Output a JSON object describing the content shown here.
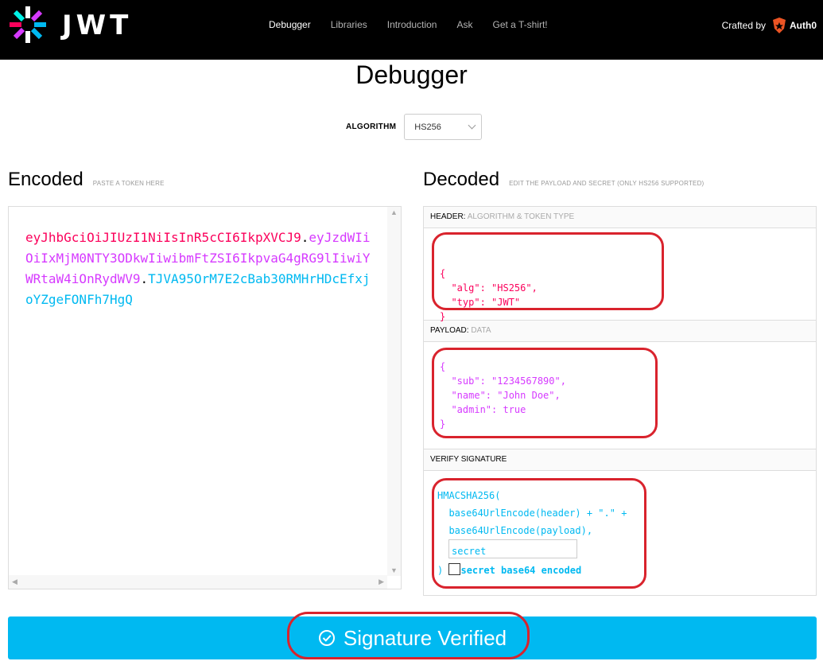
{
  "brand": {
    "name": "JWT"
  },
  "nav": {
    "items": [
      {
        "label": "Debugger"
      },
      {
        "label": "Libraries"
      },
      {
        "label": "Introduction"
      },
      {
        "label": "Ask"
      },
      {
        "label": "Get a T-shirt!"
      }
    ],
    "crafted_by": "Crafted by",
    "crafted_brand": "Auth0"
  },
  "page": {
    "title": "Debugger"
  },
  "algorithm": {
    "label": "ALGORITHM",
    "value": "HS256"
  },
  "encoded": {
    "title": "Encoded",
    "hint": "PASTE A TOKEN HERE",
    "token_header": "eyJhbGciOiJIUzI1NiIsInR5cCI6IkpXVCJ9",
    "token_payload": "eyJzdWIiOiIxMjM0NTY3ODkwIiwibmFtZSI6IkpvaG4gRG9lIiwiYWRtaW4iOnRydWV9",
    "token_signature": "TJVA95OrM7E2cBab30RMHrHDcEfxjoYZgeFONFh7HgQ",
    "dot": "."
  },
  "decoded": {
    "title": "Decoded",
    "hint": "EDIT THE PAYLOAD AND SECRET (ONLY HS256 SUPPORTED)",
    "header": {
      "label": "HEADER:",
      "sublabel": "ALGORITHM & TOKEN TYPE",
      "code": "{\n  \"alg\": \"HS256\",\n  \"typ\": \"JWT\"\n}"
    },
    "payload": {
      "label": "PAYLOAD:",
      "sublabel": "DATA",
      "code": "{\n  \"sub\": \"1234567890\",\n  \"name\": \"John Doe\",\n  \"admin\": true\n}"
    },
    "signature": {
      "label": "VERIFY SIGNATURE",
      "line1": "HMACSHA256(",
      "line2": "  base64UrlEncode(header) + \".\" +",
      "line3": "  base64UrlEncode(payload),",
      "secret_value": "secret",
      "close": ")",
      "checkbox_label": "secret base64 encoded"
    }
  },
  "status": {
    "label": "Signature Verified"
  },
  "colors": {
    "header": "#fb015b",
    "payload": "#d63aff",
    "signature": "#00b9f1",
    "highlight": "#d9232d"
  }
}
